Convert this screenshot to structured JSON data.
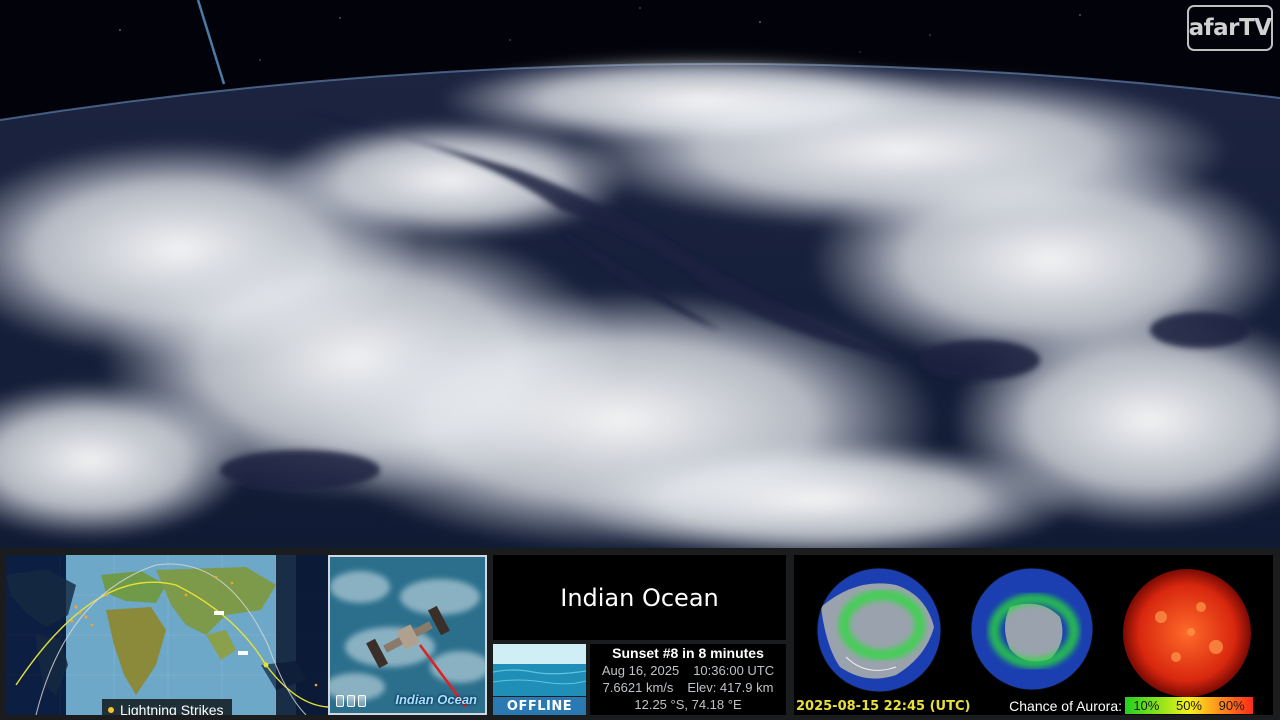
{
  "logo": {
    "text": "afarTV"
  },
  "location": {
    "name": "Indian Ocean"
  },
  "status": {
    "label": "OFFLINE"
  },
  "orbit": {
    "sunset": "Sunset #8 in 8 minutes",
    "date": "Aug 16, 2025",
    "time": "10:36:00 UTC",
    "speed": "7.6621 km/s",
    "elevation": "Elev: 417.9 km",
    "position": "12.25 °S, 74.18 °E"
  },
  "map": {
    "legend_label": "Lightning Strikes"
  },
  "iss_view": {
    "label": "Indian Ocean"
  },
  "space_weather": {
    "timestamp": "2025-08-15 22:45 (UTC)",
    "aurora_label": "Chance of Aurora:",
    "scale": [
      "10%",
      "50%",
      "90%"
    ]
  },
  "colors": {
    "accent_yellow": "#e8e03a",
    "status_blue": "#2b79b3"
  },
  "icons": [
    "lightning-dot-icon",
    "iss-station-icon",
    "aurora-north-globe",
    "aurora-south-globe",
    "sun-image"
  ]
}
